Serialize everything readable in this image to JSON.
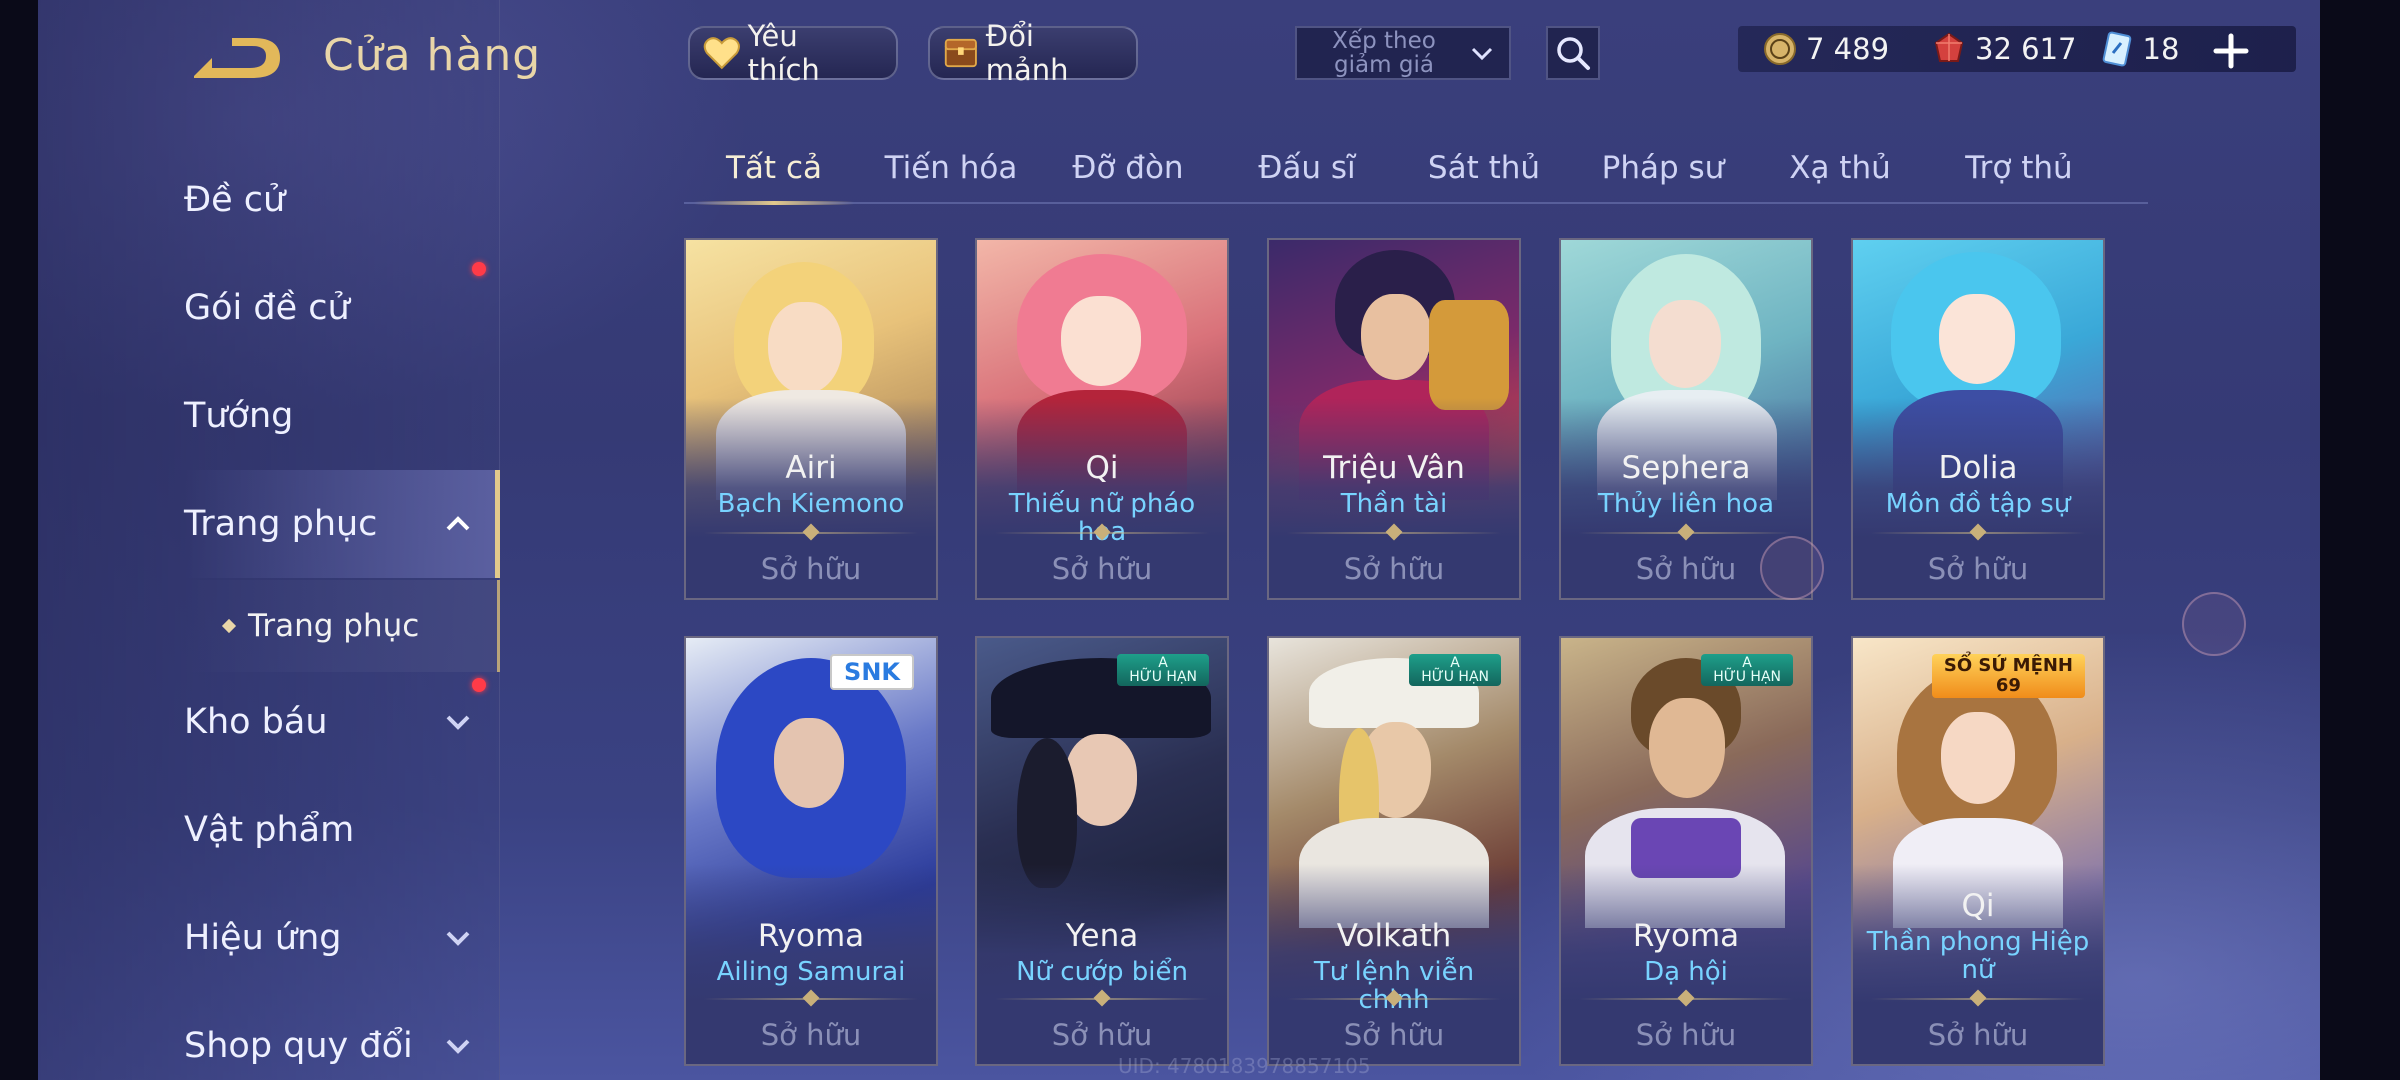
{
  "header": {
    "title": "Cửa hàng",
    "favorite_label": "Yêu thích",
    "fragment_label": "Đổi mảnh",
    "sort_label": "Xếp theo giảm giá",
    "icons": {
      "back": "back-arrow-icon",
      "favorite": "heart-icon",
      "fragment": "fragment-chest-icon",
      "sort": "chevron-down-icon",
      "search": "search-icon",
      "add": "plus-icon"
    }
  },
  "currency": {
    "gold": "7 489",
    "ruby": "32 617",
    "voucher": "18"
  },
  "sidebar": {
    "items": [
      {
        "label": "Đề cử"
      },
      {
        "label": "Gói đề cử"
      },
      {
        "label": "Tướng"
      },
      {
        "label": "Trang phục"
      },
      {
        "label": "Kho báu"
      },
      {
        "label": "Vật phẩm"
      },
      {
        "label": "Hiệu ứng"
      },
      {
        "label": "Shop quy đổi"
      }
    ],
    "sub_item": "Trang phục"
  },
  "tabs": [
    "Tất cả",
    "Tiến hóa",
    "Đỡ đòn",
    "Đấu sĩ",
    "Sát thủ",
    "Pháp sư",
    "Xạ thủ",
    "Trợ thủ"
  ],
  "cards": [
    {
      "hero": "Airi",
      "skin": "Bạch Kiemono",
      "status": "Sở hữu"
    },
    {
      "hero": "Qi",
      "skin": "Thiếu nữ pháo hoa",
      "status": "Sở hữu"
    },
    {
      "hero": "Triệu Vân",
      "skin": "Thần tài",
      "status": "Sở hữu"
    },
    {
      "hero": "Sephera",
      "skin": "Thủy liên hoa",
      "status": "Sở hữu"
    },
    {
      "hero": "Dolia",
      "skin": "Môn đồ tập sự",
      "status": "Sở hữu"
    },
    {
      "hero": "Ryoma",
      "skin": "Ailing Samurai",
      "status": "Sở hữu",
      "badge": "SNK"
    },
    {
      "hero": "Yena",
      "skin": "Nữ cướp biển",
      "status": "Sở hữu",
      "badge": "A\nHỮU HẠN"
    },
    {
      "hero": "Volkath",
      "skin": "Tư lệnh viễn chinh",
      "status": "Sở hữu",
      "badge": "A\nHỮU HẠN"
    },
    {
      "hero": "Ryoma",
      "skin": "Dạ hội",
      "status": "Sở hữu",
      "badge": "A\nHỮU HẠN"
    },
    {
      "hero": "Qi",
      "skin": "Thần phong Hiệp nữ",
      "status": "Sở hữu",
      "badge": "SỔ SỨ MỆNH\n69"
    }
  ],
  "footer": {
    "uid": "UID: 4780183978857105"
  },
  "colors": {
    "accent_gold": "#e2c98c",
    "skin_name": "#78d3ff",
    "owned_text": "#8b90b7",
    "notification": "#ff3b48"
  }
}
